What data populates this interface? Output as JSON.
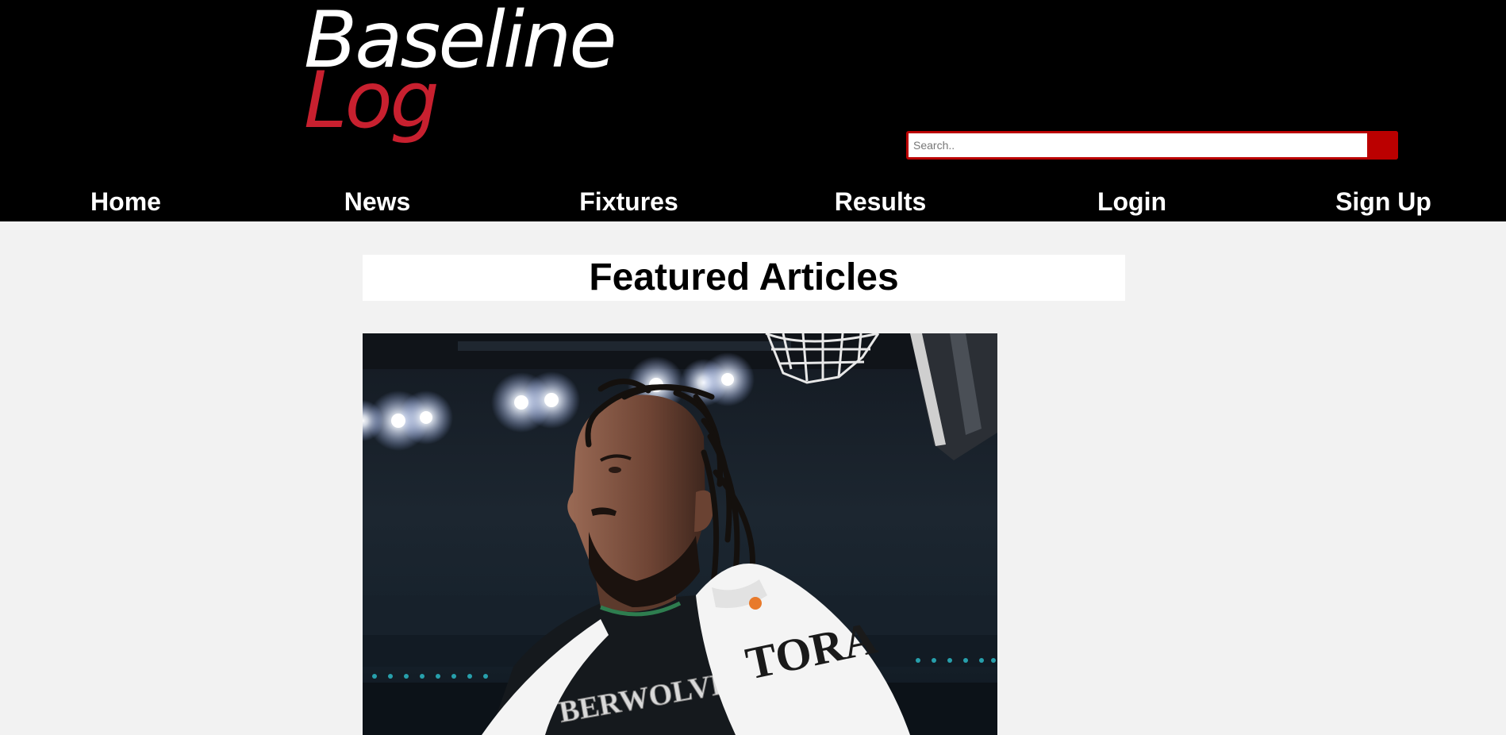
{
  "logo": {
    "line1": "Baseline",
    "line2": "Log"
  },
  "search": {
    "placeholder": "Search.."
  },
  "nav": {
    "items": [
      "Home",
      "News",
      "Fixtures",
      "Results",
      "Login",
      "Sign Up"
    ]
  },
  "main": {
    "heading": "Featured Articles",
    "article_image": {
      "jersey_text": "BERWOLVES",
      "towel_text": "TORA"
    }
  },
  "colors": {
    "header_bg": "#000000",
    "logo_white": "#ffffff",
    "logo_red": "#c8202f",
    "search_accent": "#bb0000",
    "page_bg": "#f2f2f2"
  }
}
